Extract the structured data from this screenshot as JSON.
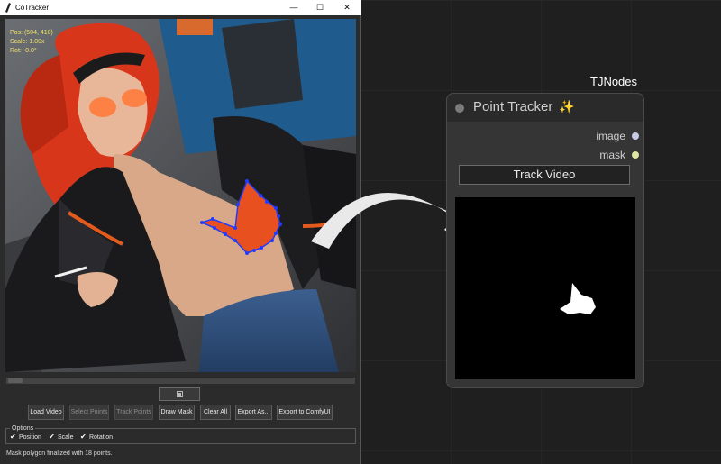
{
  "window": {
    "title": "CoTracker",
    "controls": {
      "minimize": "—",
      "maximize": "☐",
      "close": "✕"
    }
  },
  "hud": {
    "pos": "Pos: (504, 410)",
    "scale": "Scale: 1.00x",
    "rot": "Rot: -0.0°"
  },
  "toolbar": [
    {
      "label": "Load Video",
      "enabled": true
    },
    {
      "label": "Select Points",
      "enabled": false
    },
    {
      "label": "Track Points",
      "enabled": false
    },
    {
      "label": "Draw Mask",
      "enabled": true
    },
    {
      "label": "Clear All",
      "enabled": true
    },
    {
      "label": "Export As...",
      "enabled": true
    },
    {
      "label": "Export to ComfyUI",
      "enabled": true
    }
  ],
  "options": {
    "legend": "Options",
    "items": [
      {
        "label": "Position",
        "checked": true
      },
      {
        "label": "Scale",
        "checked": true
      },
      {
        "label": "Rotation",
        "checked": true
      }
    ]
  },
  "status": "Mask polygon finalized with 18 points.",
  "group_label": "TJNodes",
  "node": {
    "title": "Point Tracker",
    "title_icon": "sparkle-icon",
    "inputs": [
      {
        "label": "image",
        "color": "#c8cbe6"
      },
      {
        "label": "mask",
        "color": "#dfe6a3"
      }
    ],
    "button": "Track Video"
  },
  "colors": {
    "hud_text": "#f3e36a",
    "mask_fill": "#e8501f",
    "mask_outline": "#1f3cff",
    "window_bg": "#2b2b2b",
    "node_bg": "#353535"
  }
}
